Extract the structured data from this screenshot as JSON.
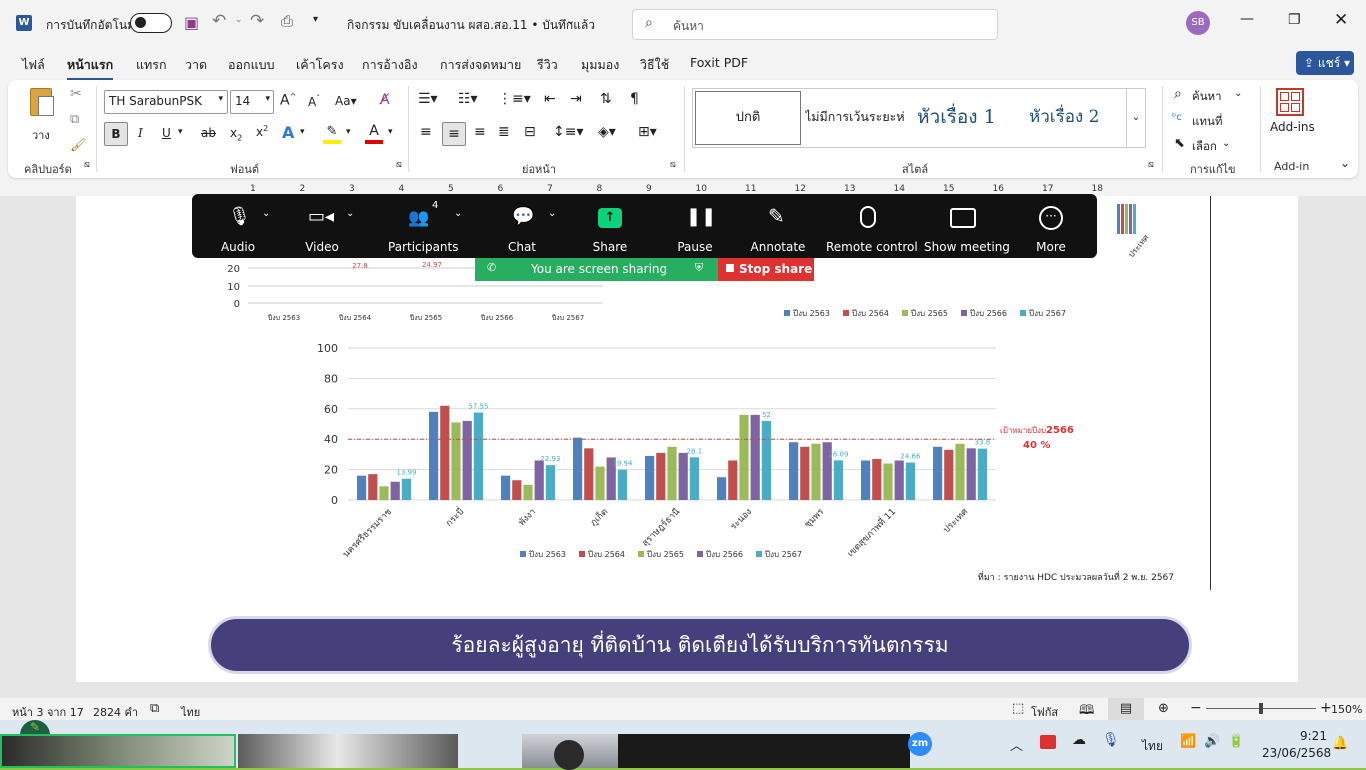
{
  "titlebar": {
    "autosave_label": "การบันทึกอัตโนมัติ",
    "doc_title": "กิจกรรม ขับเคลื่อนงาน ผสอ.สอ.11 • บันทึกแล้ว",
    "search_placeholder": "ค้นหา",
    "avatar_initials": "SB"
  },
  "menu": {
    "items": [
      "ไฟล์",
      "หน้าแรก",
      "แทรก",
      "วาด",
      "ออกแบบ",
      "เค้าโครง",
      "การอ้างอิง",
      "การส่งจดหมาย",
      "รีวิว",
      "มุมมอง",
      "วิธีใช้",
      "Foxit PDF"
    ],
    "share_label": "แชร์"
  },
  "ribbon": {
    "paste_label": "วาง",
    "clipboard_label": "คลิปบอร์ด",
    "font_name": "TH SarabunPSK",
    "font_size": "14",
    "font_label": "ฟอนต์",
    "paragraph_label": "ย่อหน้า",
    "styles": [
      "ปกติ",
      "ไม่มีการเว้นระยะห่าง",
      "หัวเรื่อง 1",
      "หัวเรื่อง 2"
    ],
    "styles_label": "สไตล์",
    "find_label": "ค้นหา",
    "replace_label": "แทนที่",
    "select_label": "เลือก",
    "editing_label": "การแก้ไข",
    "addins_button": "Add-ins",
    "addin_label": "Add-in"
  },
  "zoom": {
    "buttons": [
      "Audio",
      "Video",
      "Participants",
      "Chat",
      "Share",
      "Pause",
      "Annotate",
      "Remote control",
      "Show meeting",
      "More"
    ],
    "participants_count": "4",
    "sharing_text": "You are screen sharing",
    "stop_share": "Stop share"
  },
  "chart_data": [
    {
      "type": "line",
      "partial": true,
      "categories": [
        "ปีงบ 2563",
        "ปีงบ 2564",
        "ปีงบ 2565",
        "ปีงบ 2566",
        "ปีงบ 2567"
      ],
      "visible_labels": [
        "27.8",
        "24.97"
      ],
      "y_ticks": [
        "20",
        "10",
        "0"
      ]
    },
    {
      "type": "bar",
      "partial": true,
      "last_category": "ประเทศ",
      "legend": [
        "ปีงบ 2563",
        "ปีงบ 2564",
        "ปีงบ 2565",
        "ปีงบ 2566",
        "ปีงบ 2567"
      ]
    },
    {
      "type": "bar",
      "categories": [
        "นครศรีธรรมราช",
        "กระบี่",
        "พังงา",
        "ภูเก็ต",
        "สุราษฎร์ธานี",
        "ระนอง",
        "ชุมพร",
        "เขตสุขภาพที่ 11",
        "ประเทศ"
      ],
      "series": [
        {
          "name": "ปีงบ 2563",
          "color": "#4f81bd",
          "values": [
            16,
            58,
            16,
            41,
            29,
            15,
            38,
            26,
            35
          ]
        },
        {
          "name": "ปีงบ 2564",
          "color": "#c0504d",
          "values": [
            17,
            62,
            13,
            34,
            31,
            26,
            35,
            27,
            33
          ]
        },
        {
          "name": "ปีงบ 2565",
          "color": "#9bbb59",
          "values": [
            9,
            51,
            10,
            22,
            35,
            56,
            37,
            24,
            37
          ]
        },
        {
          "name": "ปีงบ 2566",
          "color": "#8064a2",
          "values": [
            12,
            52,
            26,
            28,
            31,
            56,
            38,
            26,
            34
          ]
        },
        {
          "name": "ปีงบ 2567",
          "color": "#4bacc6",
          "values": [
            13.99,
            57.55,
            22.93,
            19.94,
            28.1,
            52,
            26.09,
            24.66,
            33.8
          ]
        }
      ],
      "data_labels": [
        "13.99",
        "57.55",
        "22.93",
        "19.94",
        "28.1",
        "52",
        "26.09",
        "24.66",
        "33.8"
      ],
      "ylim": [
        0,
        100
      ],
      "y_ticks": [
        "0",
        "20",
        "40",
        "60",
        "80",
        "100"
      ],
      "target": {
        "value": 40,
        "label_prefix": "เป้าหมายปีงบ",
        "label_year": "2566",
        "label_value": "40 %"
      },
      "source_note": "ที่มา  : รายงาน HDC ประมวลผลวันที่ 2 พ.ย. 2567"
    }
  ],
  "banner": "ร้อยละผู้สูงอายุ ที่ติดบ้าน ติดเตียงได้รับบริการทันตกรรม",
  "status": {
    "page": "หน้า 3 จาก 17",
    "words": "2824 คำ",
    "lang": "ไทย",
    "focus": "โฟกัส",
    "zoom": "150%"
  },
  "taskbar": {
    "ime": "ไทย",
    "time": "9:21",
    "date": "23/06/2568",
    "zoom_app": "zm"
  },
  "colors": {
    "accent": "#2b579a",
    "zoom_share": "#27ae60",
    "stop": "#e03131",
    "banner": "#453f7c"
  }
}
